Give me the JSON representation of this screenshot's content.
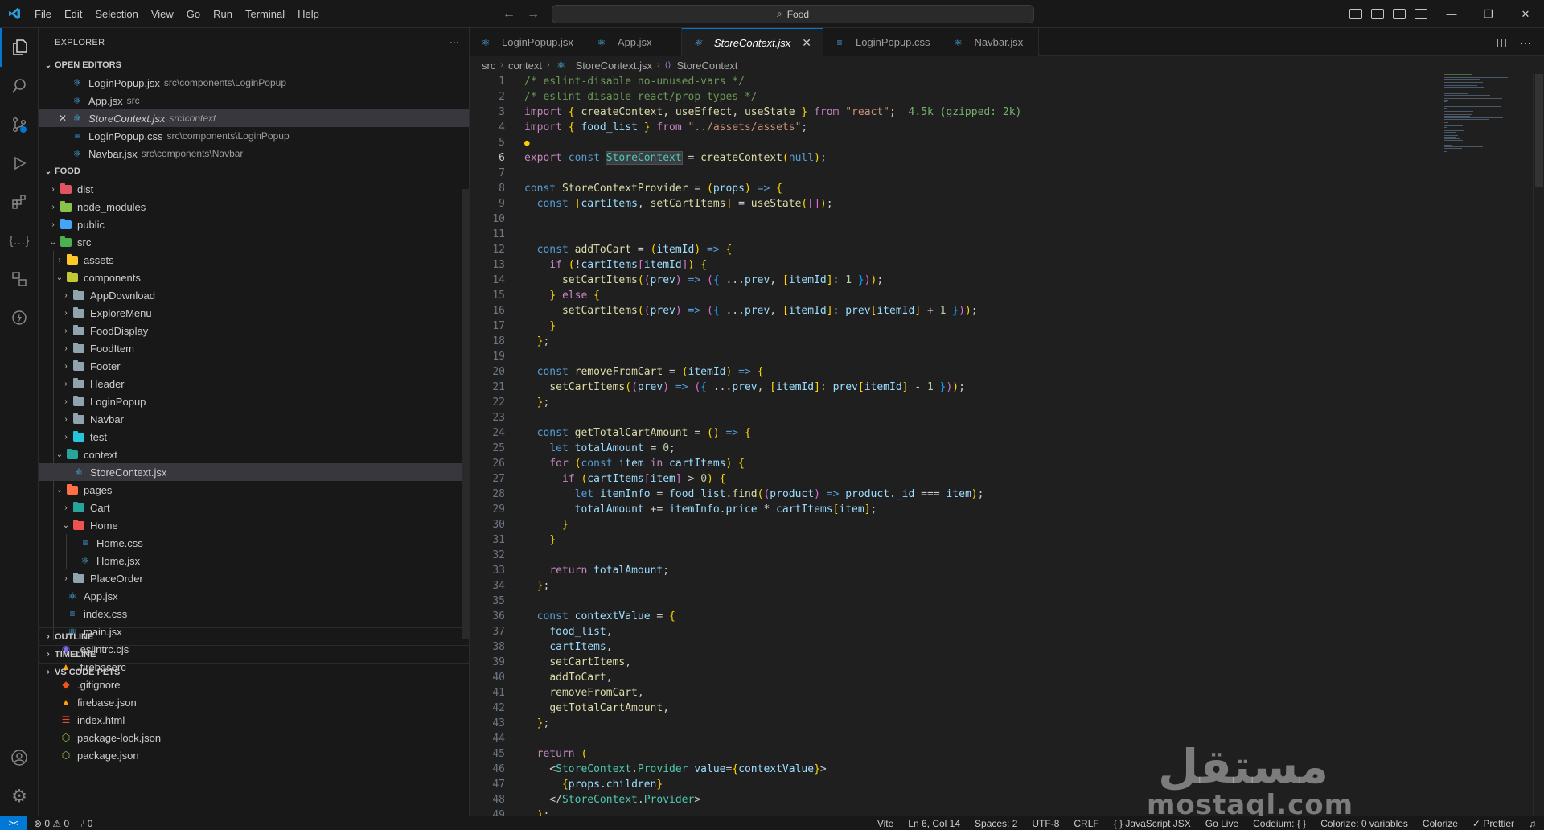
{
  "titlebar": {
    "menu": [
      "File",
      "Edit",
      "Selection",
      "View",
      "Go",
      "Run",
      "Terminal",
      "Help"
    ],
    "search_text": "Food"
  },
  "explorer": {
    "title": "EXPLORER",
    "more": "···",
    "open_editors_label": "OPEN EDITORS",
    "open_editors": [
      {
        "name": "LoginPopup.jsx",
        "path": "src\\components\\LoginPopup",
        "icon": "react-icon"
      },
      {
        "name": "App.jsx",
        "path": "src",
        "icon": "react-icon"
      },
      {
        "name": "StoreContext.jsx",
        "path": "src\\context",
        "icon": "react-icon"
      },
      {
        "name": "LoginPopup.css",
        "path": "src\\components\\LoginPopup",
        "icon": "css-icon"
      },
      {
        "name": "Navbar.jsx",
        "path": "src\\components\\Navbar",
        "icon": "react-icon"
      }
    ],
    "project_label": "FOOD",
    "tree": [
      {
        "name": "dist",
        "depth": 0,
        "type": "folder",
        "open": false,
        "color": "#e05561"
      },
      {
        "name": "node_modules",
        "depth": 0,
        "type": "folder",
        "open": false,
        "color": "#8bc34a"
      },
      {
        "name": "public",
        "depth": 0,
        "type": "folder",
        "open": false,
        "color": "#42a5f5"
      },
      {
        "name": "src",
        "depth": 0,
        "type": "folder",
        "open": true,
        "color": "#4caf50"
      },
      {
        "name": "assets",
        "depth": 1,
        "type": "folder",
        "open": false,
        "color": "#ffca28"
      },
      {
        "name": "components",
        "depth": 1,
        "type": "folder",
        "open": true,
        "color": "#c0ca33"
      },
      {
        "name": "AppDownload",
        "depth": 2,
        "type": "folder",
        "open": false,
        "color": "#90a4ae"
      },
      {
        "name": "ExploreMenu",
        "depth": 2,
        "type": "folder",
        "open": false,
        "color": "#90a4ae"
      },
      {
        "name": "FoodDisplay",
        "depth": 2,
        "type": "folder",
        "open": false,
        "color": "#90a4ae"
      },
      {
        "name": "FoodItem",
        "depth": 2,
        "type": "folder",
        "open": false,
        "color": "#90a4ae"
      },
      {
        "name": "Footer",
        "depth": 2,
        "type": "folder",
        "open": false,
        "color": "#90a4ae"
      },
      {
        "name": "Header",
        "depth": 2,
        "type": "folder",
        "open": false,
        "color": "#90a4ae"
      },
      {
        "name": "LoginPopup",
        "depth": 2,
        "type": "folder",
        "open": false,
        "color": "#90a4ae"
      },
      {
        "name": "Navbar",
        "depth": 2,
        "type": "folder",
        "open": false,
        "color": "#90a4ae"
      },
      {
        "name": "test",
        "depth": 2,
        "type": "folder",
        "open": false,
        "color": "#26c6da"
      },
      {
        "name": "context",
        "depth": 1,
        "type": "folder",
        "open": true,
        "color": "#26a69a"
      },
      {
        "name": "StoreContext.jsx",
        "depth": 2,
        "type": "file",
        "icon": "react-icon",
        "selected": true
      },
      {
        "name": "pages",
        "depth": 1,
        "type": "folder",
        "open": true,
        "color": "#ff7043"
      },
      {
        "name": "Cart",
        "depth": 2,
        "type": "folder",
        "open": false,
        "color": "#26a69a"
      },
      {
        "name": "Home",
        "depth": 2,
        "type": "folder",
        "open": true,
        "color": "#ef5350"
      },
      {
        "name": "Home.css",
        "depth": 3,
        "type": "file",
        "icon": "css-icon"
      },
      {
        "name": "Home.jsx",
        "depth": 3,
        "type": "file",
        "icon": "react-icon"
      },
      {
        "name": "PlaceOrder",
        "depth": 2,
        "type": "folder",
        "open": false,
        "color": "#90a4ae"
      },
      {
        "name": "App.jsx",
        "depth": 1,
        "type": "file",
        "icon": "react-icon"
      },
      {
        "name": "index.css",
        "depth": 1,
        "type": "file",
        "icon": "css-icon"
      },
      {
        "name": "main.jsx",
        "depth": 1,
        "type": "file",
        "icon": "react-icon"
      },
      {
        "name": ".eslintrc.cjs",
        "depth": 0,
        "type": "file",
        "icon": "eslint-icon"
      },
      {
        "name": ".firebaserc",
        "depth": 0,
        "type": "file",
        "icon": "firebase-icon"
      },
      {
        "name": ".gitignore",
        "depth": 0,
        "type": "file",
        "icon": "git-icon"
      },
      {
        "name": "firebase.json",
        "depth": 0,
        "type": "file",
        "icon": "firebase-icon"
      },
      {
        "name": "index.html",
        "depth": 0,
        "type": "file",
        "icon": "html-icon"
      },
      {
        "name": "package-lock.json",
        "depth": 0,
        "type": "file",
        "icon": "npm-icon"
      },
      {
        "name": "package.json",
        "depth": 0,
        "type": "file",
        "icon": "npm-icon"
      }
    ],
    "bottom_sections": [
      "OUTLINE",
      "TIMELINE",
      "VS CODE PETS"
    ]
  },
  "tabs": [
    {
      "label": "LoginPopup.jsx",
      "icon": "react-icon",
      "active": false
    },
    {
      "label": "App.jsx",
      "icon": "react-icon",
      "active": false
    },
    {
      "label": "StoreContext.jsx",
      "icon": "react-icon",
      "active": true
    },
    {
      "label": "LoginPopup.css",
      "icon": "css-icon",
      "active": false
    },
    {
      "label": "Navbar.jsx",
      "icon": "react-icon",
      "active": false
    }
  ],
  "breadcrumb": [
    "src",
    "context",
    "StoreContext.jsx",
    "StoreContext"
  ],
  "code": {
    "current_line": 6,
    "lines": [
      "/* eslint-disable no-unused-vars */",
      "/* eslint-disable react/prop-types */",
      "import { createContext, useEffect, useState } from \"react\";  4.5k (gzipped: 2k)",
      "import { food_list } from \"../assets/assets\";",
      "",
      "export const StoreContext = createContext(null);",
      "",
      "const StoreContextProvider = (props) => {",
      "  const [cartItems, setCartItems] = useState([]);",
      "",
      "",
      "  const addToCart = (itemId) => {",
      "    if (!cartItems[itemId]) {",
      "      setCartItems((prev) => ({ ...prev, [itemId]: 1 }));",
      "    } else {",
      "      setCartItems((prev) => ({ ...prev, [itemId]: prev[itemId] + 1 }));",
      "    }",
      "  };",
      "",
      "  const removeFromCart = (itemId) => {",
      "    setCartItems((prev) => ({ ...prev, [itemId]: prev[itemId] - 1 }));",
      "  };",
      "",
      "  const getTotalCartAmount = () => {",
      "    let totalAmount = 0;",
      "    for (const item in cartItems) {",
      "      if (cartItems[item] > 0) {",
      "        let itemInfo = food_list.find((product) => product._id === item);",
      "        totalAmount += itemInfo.price * cartItems[item];",
      "      }",
      "    }",
      "",
      "    return totalAmount;",
      "  };",
      "",
      "  const contextValue = {",
      "    food_list,",
      "    cartItems,",
      "    setCartItems,",
      "    addToCart,",
      "    removeFromCart,",
      "    getTotalCartAmount,",
      "  };",
      "",
      "  return (",
      "    <StoreContext.Provider value={contextValue}>",
      "      {props.children}",
      "    </StoreContext.Provider>",
      "  );"
    ]
  },
  "watermark": {
    "arabic": "مستقل",
    "latin": "mostaql.com"
  },
  "statusbar": {
    "remote": "><",
    "problems": "⊗ 0 ⚠ 0",
    "ports": "⑂ 0",
    "items": [
      "Vite",
      "Ln 6, Col 14",
      "Spaces: 2",
      "UTF-8",
      "CRLF",
      "{ } JavaScript JSX",
      "Go Live",
      "Codeium: { }",
      "Colorize: 0 variables",
      "Colorize",
      "✓ Prettier"
    ]
  },
  "colors": {
    "accent": "#0078d4",
    "background": "#1f1f1f",
    "sidebar": "#181818"
  }
}
